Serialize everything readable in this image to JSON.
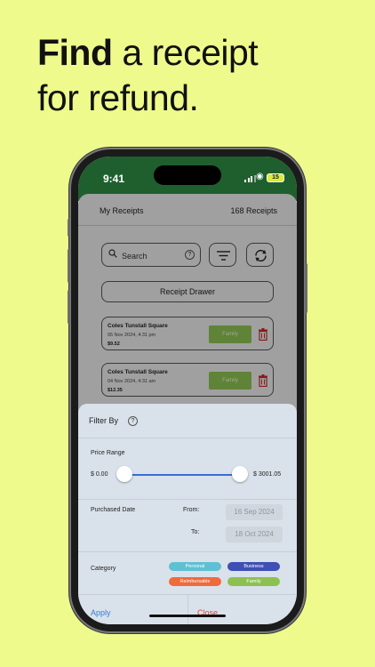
{
  "headline": {
    "bold": "Find",
    "rest": " a receipt",
    "line2": "for refund."
  },
  "status_bar": {
    "time": "9:41",
    "battery": "15"
  },
  "app": {
    "title": "My Receipts",
    "receipt_count": "168 Receipts",
    "search_placeholder": "Search",
    "drawer_button": "Receipt Drawer",
    "receipts": [
      {
        "name": "Coles Tunstall Square",
        "date": "05 Nov 2024, 4:31 pm",
        "amount": "$9.52",
        "tag": "Family"
      },
      {
        "name": "Coles Tunstall Square",
        "date": "04 Nov 2024, 4:31 am",
        "amount": "$12.35",
        "tag": "Family"
      }
    ]
  },
  "filter": {
    "title": "Filter By",
    "price_range_label": "Price Range",
    "price_min": "$ 0.00",
    "price_max": "$ 3001.05",
    "slider_low": 0,
    "slider_high": 1,
    "purchased_date_label": "Purchased Date",
    "from_label": "From:",
    "to_label": "To:",
    "from_date": "16 Sep 2024",
    "to_date": "18 Oct 2024",
    "category_label": "Category",
    "categories": [
      {
        "label": "Personal",
        "color": "#5fc0d3"
      },
      {
        "label": "Business",
        "color": "#3f4fb5"
      },
      {
        "label": "Reimbursable",
        "color": "#ef6a3c"
      },
      {
        "label": "Family",
        "color": "#8cc151"
      }
    ],
    "apply_label": "Apply",
    "close_label": "Close",
    "apply_color": "#3a7bd5",
    "close_color": "#e53935"
  },
  "colors": {
    "background": "#eefb8c",
    "status_bar": "#1f5f2e"
  }
}
